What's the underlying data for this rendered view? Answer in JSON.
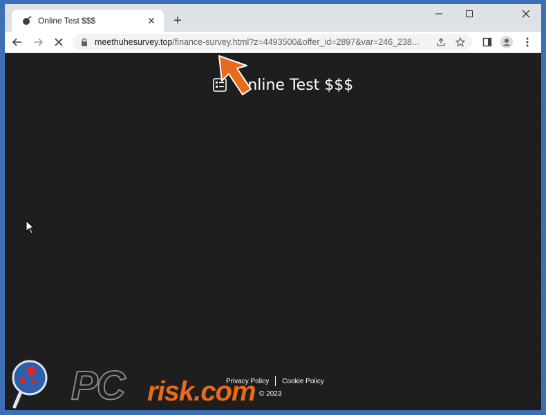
{
  "browser": {
    "tab": {
      "title": "Online Test $$$",
      "favicon": "bomb-favicon-icon"
    },
    "new_tab_label": "+",
    "window_controls": [
      "minimize-icon",
      "maximize-icon",
      "close-icon"
    ],
    "address": {
      "host": "meethuhesurvey.top",
      "path": "/finance-survey.html?z=4493500&offer_id=2897&var=246_238..."
    }
  },
  "page": {
    "title": "Online Test $$$",
    "footer": {
      "privacy": "Privacy Policy",
      "cookie": "Cookie Policy",
      "copyright": "© 2023"
    }
  },
  "watermark": {
    "brand_left": "PC",
    "brand_right": "risk.com"
  },
  "colors": {
    "accent": "#e86a1a",
    "page_bg": "#1c1c1c",
    "frame": "#3b6fb6"
  }
}
